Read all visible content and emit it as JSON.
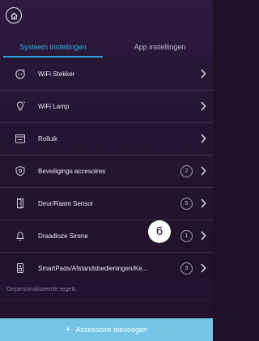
{
  "header": {
    "tabs": [
      {
        "label": "Systeem instellingen",
        "active": true
      },
      {
        "label": "App instellingen",
        "active": false
      }
    ]
  },
  "items": [
    {
      "label": "WiFi Stekker",
      "icon": "smart-plug-icon"
    },
    {
      "label": "WiFi Lamp",
      "icon": "bulb-icon"
    },
    {
      "label": "Rolluik",
      "icon": "shutter-icon"
    },
    {
      "label": "Beveiligings accesoires",
      "icon": "shield-icon",
      "count": "2"
    },
    {
      "label": "Deur/Raam Sensor",
      "icon": "door-sensor-icon",
      "count": "5"
    },
    {
      "label": "Draadloze Sirene",
      "icon": "bell-icon",
      "count": "1"
    },
    {
      "label": "SmartPads/Afstandsbedieningen/Ke...",
      "icon": "remote-icon",
      "count": "3"
    }
  ],
  "callout": "6",
  "section": {
    "label": "Gepersonaliseerde regels"
  },
  "add_button": {
    "label": "Accessoire toevoegen",
    "icon": "plus-icon"
  },
  "colors": {
    "accent": "#2fb0dd",
    "add_bar": "#74c4e8",
    "background": "#241431"
  }
}
